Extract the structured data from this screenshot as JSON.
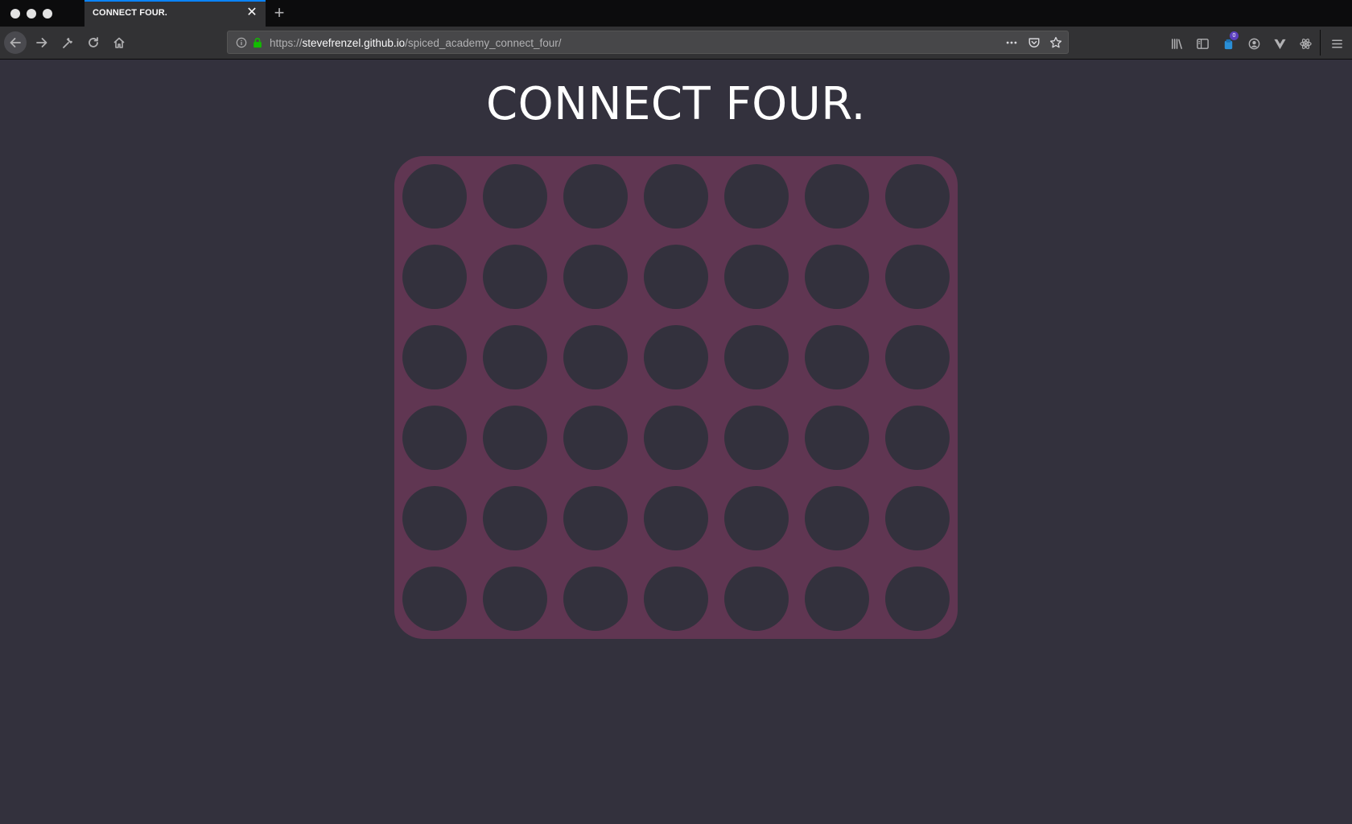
{
  "browser": {
    "tab": {
      "title": "CONNECT FOUR."
    },
    "url": {
      "scheme": "https://",
      "host": "stevefrenzel.github.io",
      "path": "/spiced_academy_connect_four/"
    },
    "toolbar_badge": "0",
    "accent_color": "#0a84ff"
  },
  "page": {
    "title": "CONNECT FOUR.",
    "colors": {
      "background": "#33313d",
      "board": "#603652",
      "empty_slot": "#33313d"
    }
  },
  "game_board": {
    "columns": 7,
    "rows": 6,
    "cells": [
      [
        "empty",
        "empty",
        "empty",
        "empty",
        "empty",
        "empty",
        "empty"
      ],
      [
        "empty",
        "empty",
        "empty",
        "empty",
        "empty",
        "empty",
        "empty"
      ],
      [
        "empty",
        "empty",
        "empty",
        "empty",
        "empty",
        "empty",
        "empty"
      ],
      [
        "empty",
        "empty",
        "empty",
        "empty",
        "empty",
        "empty",
        "empty"
      ],
      [
        "empty",
        "empty",
        "empty",
        "empty",
        "empty",
        "empty",
        "empty"
      ],
      [
        "empty",
        "empty",
        "empty",
        "empty",
        "empty",
        "empty",
        "empty"
      ]
    ]
  }
}
